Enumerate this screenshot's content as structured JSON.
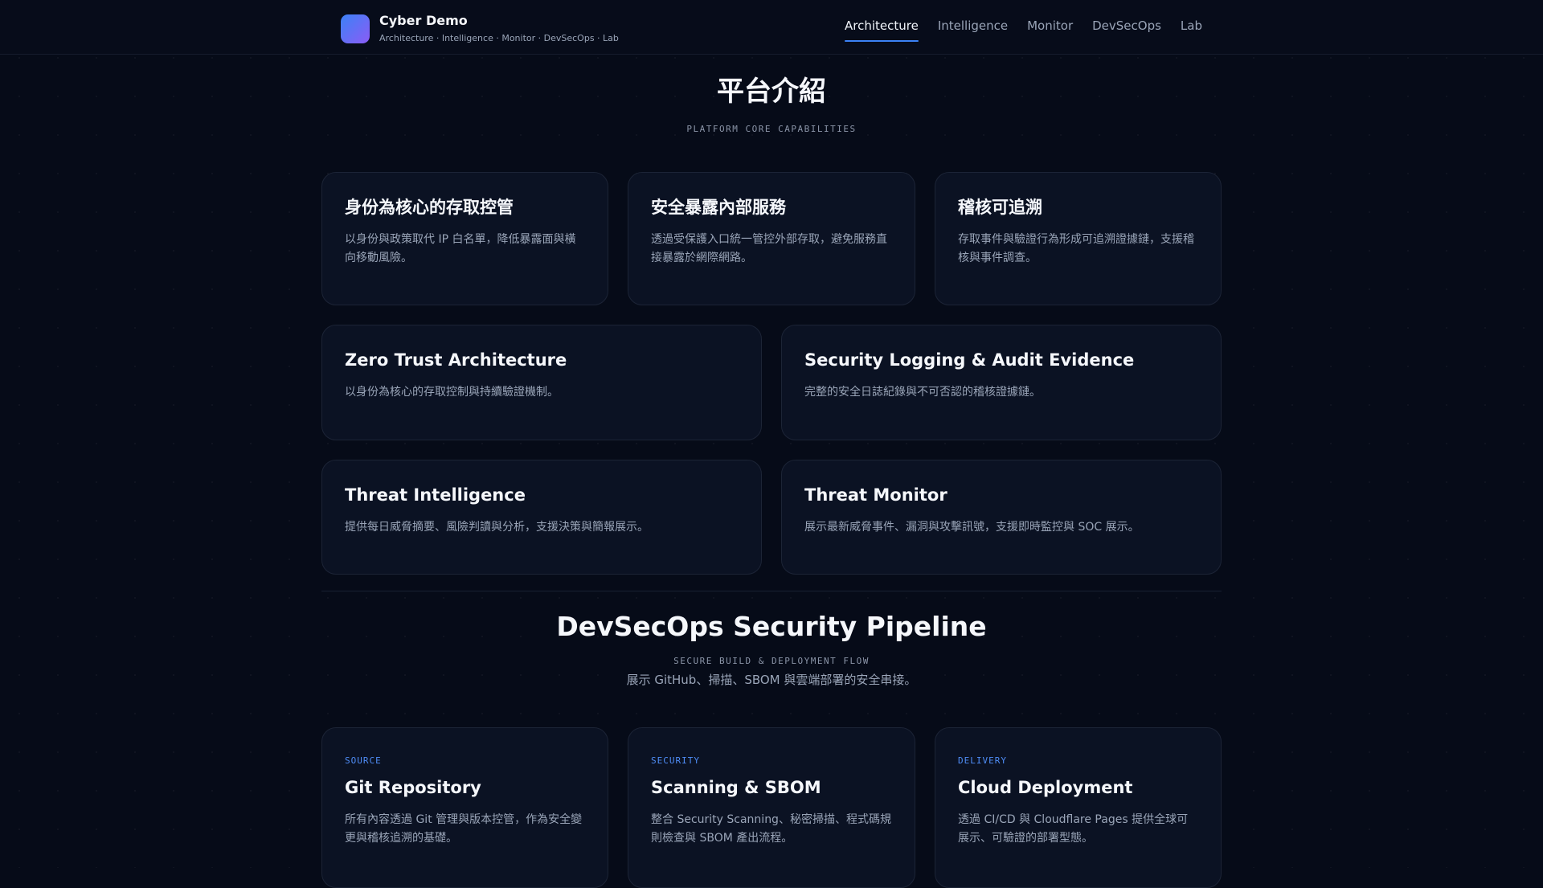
{
  "brand": {
    "name": "Cyber Demo",
    "subtitle": "Architecture · Intelligence · Monitor · DevSecOps · Lab"
  },
  "nav": {
    "items": [
      {
        "label": "Architecture",
        "active": true
      },
      {
        "label": "Intelligence",
        "active": false
      },
      {
        "label": "Monitor",
        "active": false
      },
      {
        "label": "DevSecOps",
        "active": false
      },
      {
        "label": "Lab",
        "active": false
      }
    ]
  },
  "platform": {
    "title": "平台介紹",
    "kicker": "PLATFORM CORE CAPABILITIES",
    "cards_top": [
      {
        "title": "身份為核心的存取控管",
        "desc": "以身份與政策取代 IP 白名單，降低暴露面與橫向移動風險。"
      },
      {
        "title": "安全暴露內部服務",
        "desc": "透過受保護入口統一管控外部存取，避免服務直接暴露於網際網路。"
      },
      {
        "title": "稽核可追溯",
        "desc": "存取事件與驗證行為形成可追溯證據鏈，支援稽核與事件調查。"
      }
    ],
    "cards_wide": [
      {
        "title": "Zero Trust Architecture",
        "desc": "以身份為核心的存取控制與持續驗證機制。"
      },
      {
        "title": "Security Logging & Audit Evidence",
        "desc": "完整的安全日誌紀錄與不可否認的稽核證據鏈。"
      },
      {
        "title": "Threat Intelligence",
        "desc": "提供每日威脅摘要、風險判讀與分析，支援決策與簡報展示。"
      },
      {
        "title": "Threat Monitor",
        "desc": "展示最新威脅事件、漏洞與攻擊訊號，支援即時監控與 SOC 展示。"
      }
    ]
  },
  "pipeline": {
    "title": "DevSecOps Security Pipeline",
    "kicker": "SECURE BUILD & DEPLOYMENT FLOW",
    "description": "展示 GitHub、掃描、SBOM 與雲端部署的安全串接。",
    "cards": [
      {
        "tag": "SOURCE",
        "title": "Git Repository",
        "desc": "所有內容透過 Git 管理與版本控管，作為安全變更與稽核追溯的基礎。"
      },
      {
        "tag": "SECURITY",
        "title": "Scanning & SBOM",
        "desc": "整合 Security Scanning、秘密掃描、程式碼規則檢查與 SBOM 產出流程。"
      },
      {
        "tag": "DELIVERY",
        "title": "Cloud Deployment",
        "desc": "透過 CI/CD 與 Cloudflare Pages 提供全球可展示、可驗證的部署型態。"
      }
    ]
  }
}
